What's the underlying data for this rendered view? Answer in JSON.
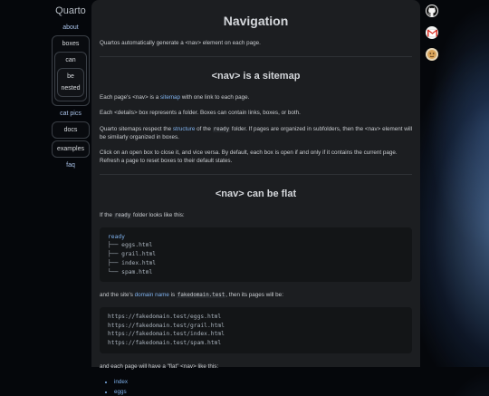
{
  "sidebar": {
    "brand": "Quarto",
    "about": "about",
    "boxes": "boxes",
    "can": "can",
    "be": "be",
    "nested": "nested",
    "cat_pics": "cat pics",
    "docs": "docs",
    "examples": "examples",
    "faq": "faq"
  },
  "main": {
    "title": "Navigation",
    "intro": "Quartos automatically generate a <nav> element on each page.",
    "section1": {
      "heading": "<nav> is a sitemap",
      "p1_a": "Each page's <nav> is a ",
      "p1_link": "sitemap",
      "p1_b": " with one link to each page.",
      "p2": "Each <details> box represents a folder. Boxes can contain links, boxes, or both.",
      "p3_a": "Quarto sitemaps respect the ",
      "p3_link": "structure",
      "p3_b": " of the ",
      "p3_code": "ready",
      "p3_c": " folder. If pages are organized in subfolders, then the <nav> element will be similarly organized in boxes.",
      "p4": "Click on an open box to close it, and vice versa. By default, each box is open if and only if it contains the current page. Refresh a page to reset boxes to their default states."
    },
    "section2": {
      "heading": "<nav> can be flat",
      "p1_a": "If the ",
      "p1_code": "ready",
      "p1_b": " folder looks like this:",
      "tree_root": "ready",
      "tree_lines": [
        "├── eggs.html",
        "├── grail.html",
        "├── index.html",
        "└── spam.html"
      ],
      "p2_a": "and the site's ",
      "p2_link": "domain name",
      "p2_b": " is ",
      "p2_code": "fakedomain.test",
      "p2_c": ", then its pages will be:",
      "urls": [
        "https://fakedomain.test/eggs.html",
        "https://fakedomain.test/grail.html",
        "https://fakedomain.test/index.html",
        "https://fakedomain.test/spam.html"
      ],
      "p3": "and each page will have a \"flat\" <nav> like this:",
      "list": [
        "index",
        "eggs"
      ]
    }
  },
  "icons": [
    "github-icon",
    "gmail-icon",
    "avatar-icon"
  ]
}
